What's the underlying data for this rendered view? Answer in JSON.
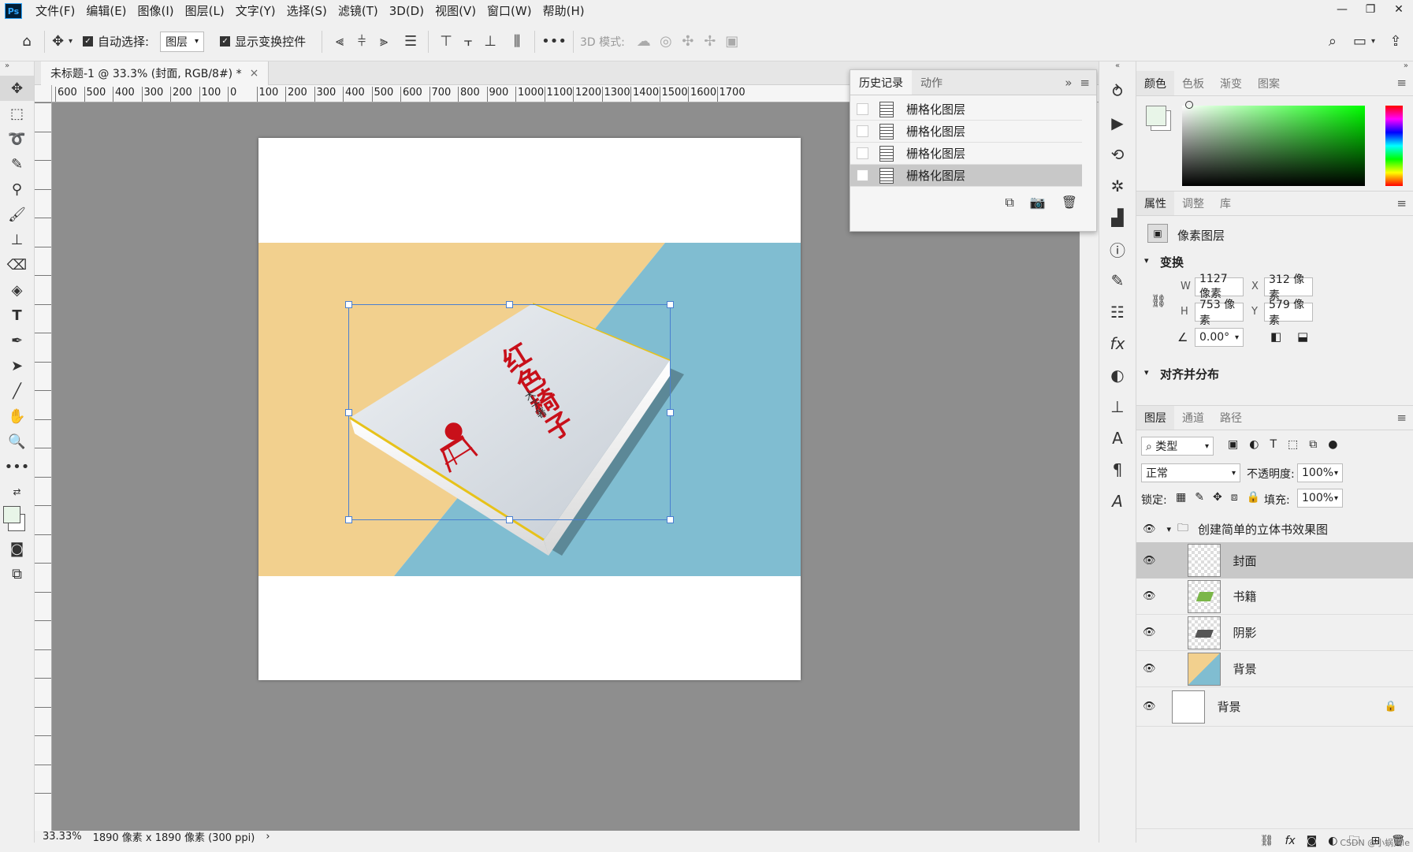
{
  "menubar": {
    "logo": "Ps",
    "items": [
      "文件(F)",
      "编辑(E)",
      "图像(I)",
      "图层(L)",
      "文字(Y)",
      "选择(S)",
      "滤镜(T)",
      "3D(D)",
      "视图(V)",
      "窗口(W)",
      "帮助(H)"
    ],
    "window_controls": [
      "—",
      "❐",
      "✕"
    ]
  },
  "options": {
    "auto_select_label": "自动选择:",
    "auto_select_target": "图层",
    "show_transform_label": "显示变换控件",
    "mode_3d_label": "3D 模式:"
  },
  "document": {
    "tab_title": "未标题-1 @ 33.3% (封面, RGB/8#) *",
    "tab_close": "×",
    "ruler_h": [
      "600",
      "500",
      "400",
      "300",
      "200",
      "100",
      "0",
      "100",
      "200",
      "300",
      "400",
      "500",
      "600",
      "700",
      "800",
      "900",
      "1000",
      "1100",
      "1200",
      "1300",
      "1400",
      "1500",
      "1600",
      "1700"
    ],
    "book_title": "红色椅子",
    "book_author": "木子著",
    "status_zoom": "33.33%",
    "status_info": "1890 像素 x 1890 像素 (300 ppi)",
    "status_arrow": "›"
  },
  "history": {
    "tabs": [
      "历史记录",
      "动作"
    ],
    "rows": [
      "栅格化图层",
      "栅格化图层",
      "栅格化图层",
      "栅格化图层"
    ],
    "selected_index": 3
  },
  "color_panel": {
    "tabs": [
      "颜色",
      "色板",
      "渐变",
      "图案"
    ]
  },
  "properties": {
    "tabs": [
      "属性",
      "调整",
      "库"
    ],
    "layer_type": "像素图层",
    "transform_title": "变换",
    "w_label": "W",
    "w_value": "1127 像素",
    "h_label": "H",
    "h_value": "753 像素",
    "x_label": "X",
    "x_value": "312 像素",
    "y_label": "Y",
    "y_value": "579 像素",
    "angle_value": "0.00°",
    "align_title": "对齐并分布"
  },
  "layers": {
    "tabs": [
      "图层",
      "通道",
      "路径"
    ],
    "filter_label": "类型",
    "blend_mode": "正常",
    "opacity_label": "不透明度:",
    "opacity_value": "100%",
    "lock_label": "锁定:",
    "fill_label": "填充:",
    "fill_value": "100%",
    "group_name": "创建简单的立体书效果图",
    "items": [
      "封面",
      "书籍",
      "阴影",
      "背景"
    ],
    "background_name": "背景",
    "watermark": "CSDN @小蜗大le"
  },
  "colors": {
    "canvas_bg": "#8e8e8e",
    "orange": "#f2d08e",
    "blue": "#80bdd1",
    "selection": "#4a7fd0",
    "title_red": "#c8101a"
  }
}
